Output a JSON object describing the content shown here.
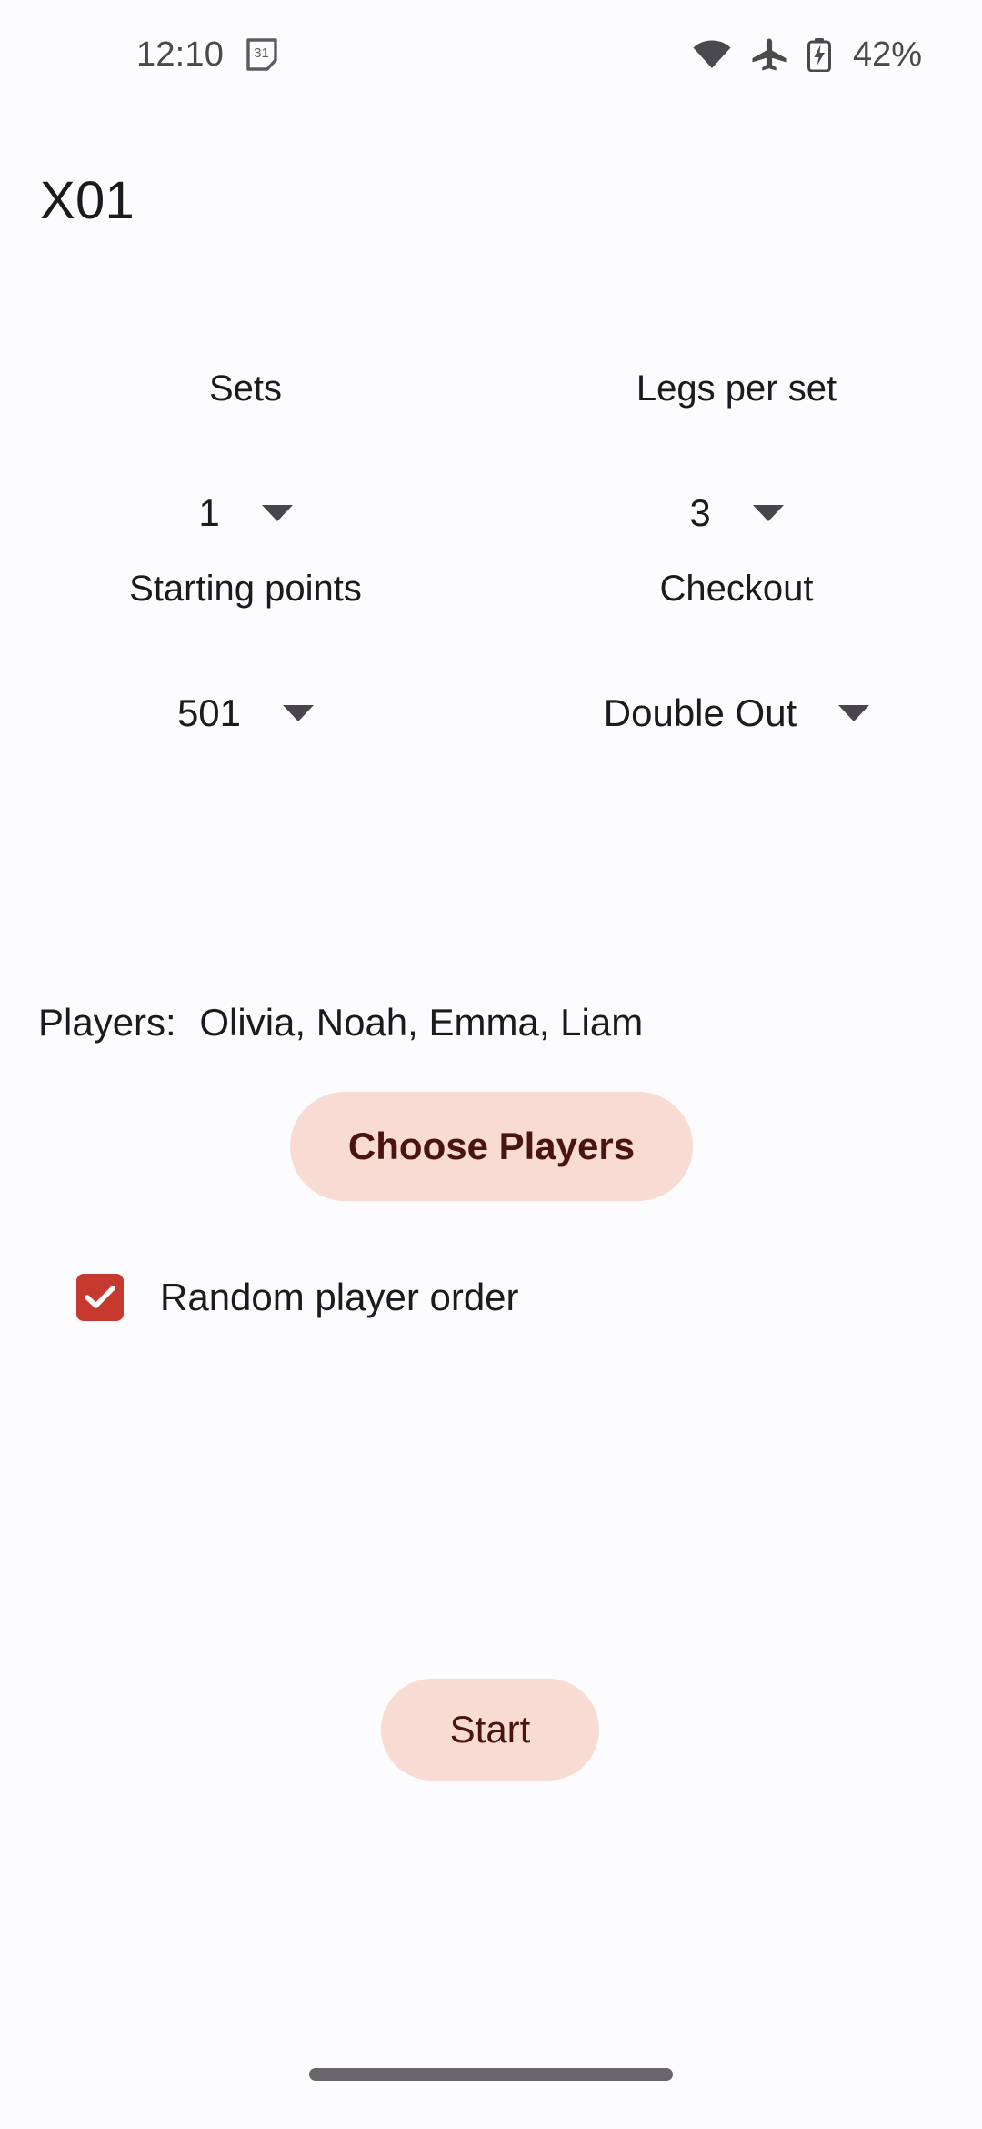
{
  "status_bar": {
    "time": "12:10",
    "calendar_icon": "calendar-31-icon",
    "calendar_day": "31",
    "wifi_icon": "wifi-icon",
    "airplane_icon": "airplane-mode-icon",
    "battery_icon": "battery-charging-icon",
    "battery_percent": "42%"
  },
  "header": {
    "title": "X01"
  },
  "settings": {
    "sets": {
      "label": "Sets",
      "value": "1"
    },
    "legs_per_set": {
      "label": "Legs per set",
      "value": "3"
    },
    "starting_points": {
      "label": "Starting points",
      "value": "501"
    },
    "checkout": {
      "label": "Checkout",
      "value": "Double Out"
    }
  },
  "players": {
    "label": "Players:",
    "names": "Olivia, Noah, Emma, Liam",
    "choose_button": "Choose Players"
  },
  "random_order": {
    "label": "Random player order",
    "checked": "true"
  },
  "actions": {
    "start_button": "Start"
  },
  "colors": {
    "background": "#FCFBFD",
    "button_fill": "#F8DCD4",
    "button_text": "#4B1410",
    "checkbox_fill": "#C6392F",
    "text_primary": "#1B1B1F",
    "status_icon": "#4A4A4E",
    "nav_pill": "#68666C"
  }
}
